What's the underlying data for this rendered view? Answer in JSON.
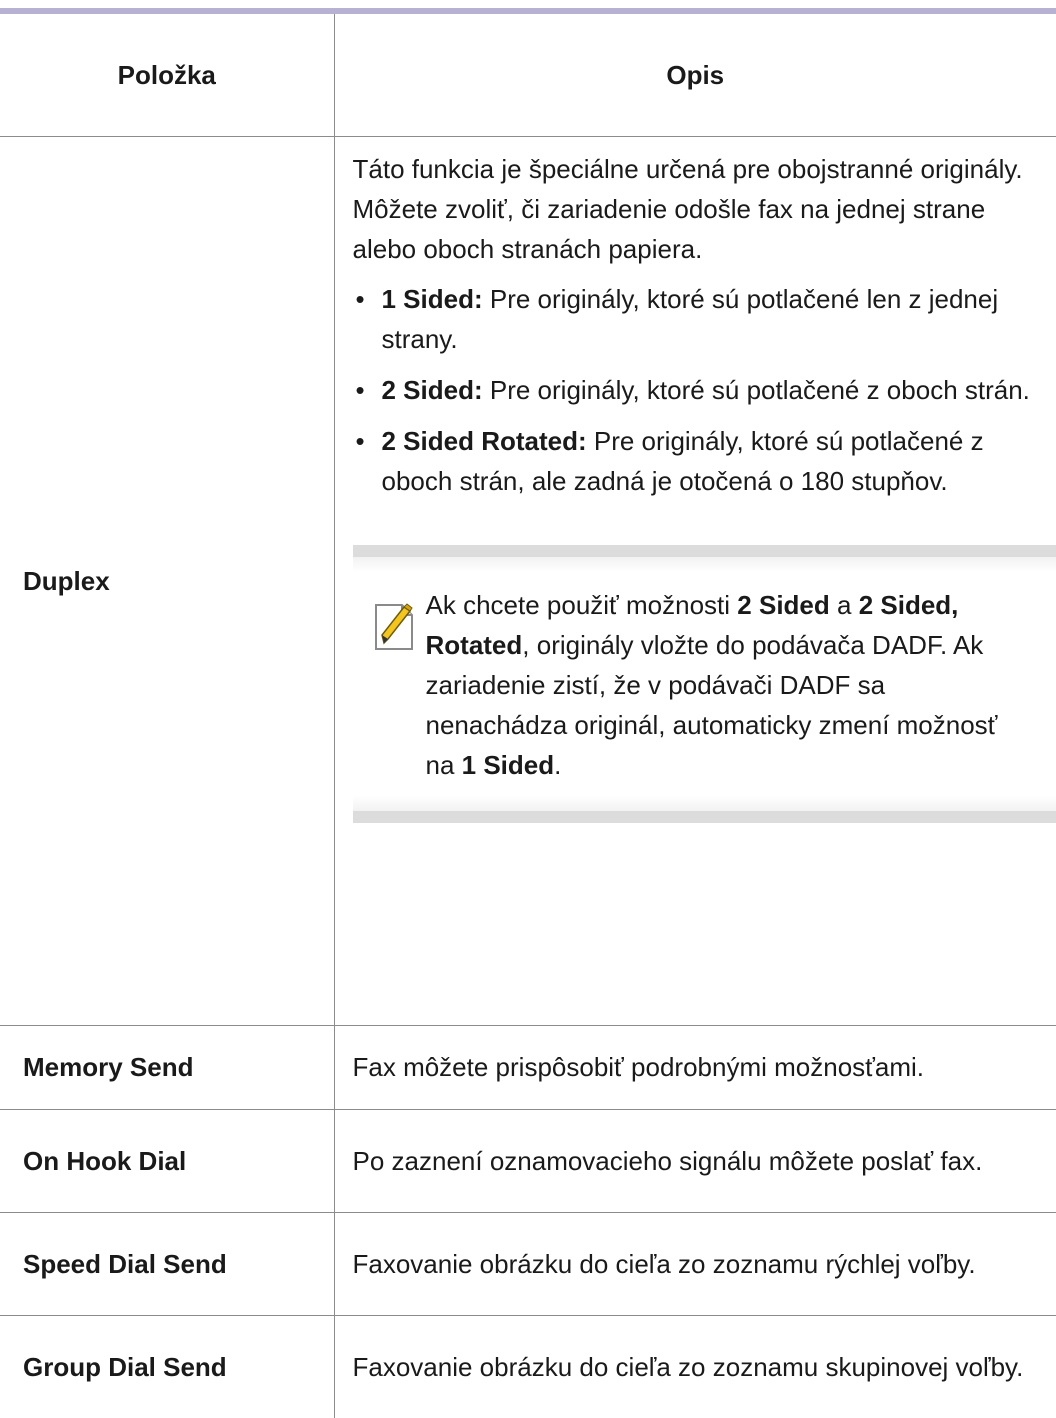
{
  "table": {
    "headers": {
      "item": "Položka",
      "description": "Opis"
    },
    "duplex": {
      "item": "Duplex",
      "intro": "Táto funkcia je špeciálne určená pre obojstranné originály. Môžete zvoliť, či zariadenie odošle fax na jednej strane alebo oboch stranách papiera.",
      "options": [
        {
          "term": "1 Sided:",
          "text": " Pre originály, ktoré sú potlačené len z jednej strany."
        },
        {
          "term": "2 Sided:",
          "text": " Pre originály, ktoré sú potlačené z oboch strán."
        },
        {
          "term": "2 Sided Rotated:",
          "text": " Pre originály, ktoré sú potlačené z oboch strán, ale zadná je otočená o 180 stupňov."
        }
      ],
      "note": {
        "t1": "Ak chcete použiť možnosti ",
        "b1": "2 Sided",
        "t2": " a ",
        "b2": "2 Sided, Rotated",
        "t3": ", originály vložte do podávača DADF. Ak zariadenie zistí, že v podávači DADF sa nenachádza originál, automaticky zmení možnosť na ",
        "b3": "1 Sided",
        "t4": "."
      }
    },
    "rows": [
      {
        "item": "Memory Send",
        "description": "Fax môžete prispôsobiť podrobnými možnosťami."
      },
      {
        "item": "On Hook Dial",
        "description": "Po zaznení oznamovacieho signálu môžete poslať fax."
      },
      {
        "item": "Speed Dial Send",
        "description": "Faxovanie obrázku do cieľa zo zoznamu rýchlej voľby."
      },
      {
        "item": "Group Dial Send",
        "description": "Faxovanie obrázku do cieľa zo zoznamu skupinovej voľby."
      }
    ]
  },
  "note_icon": "note-pencil-icon",
  "colors": {
    "header_rule": "#b7b2d3",
    "grid": "#8c8c8c",
    "note_band": "#dcdcdc"
  }
}
